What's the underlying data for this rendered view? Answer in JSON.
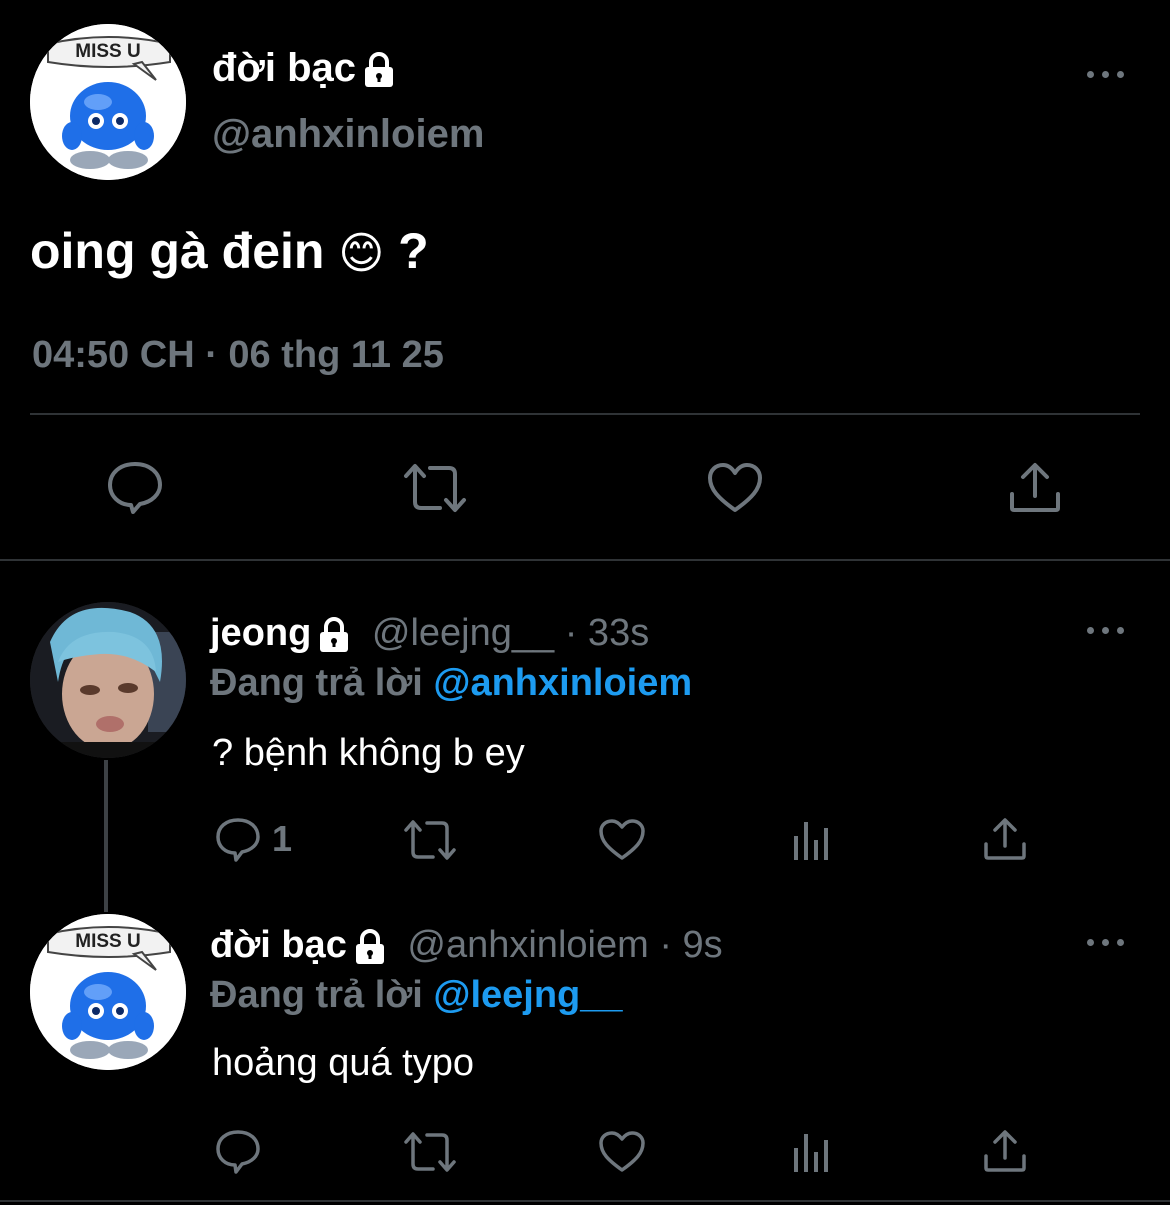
{
  "main_tweet": {
    "display_name": "đời bạc",
    "handle": "@anhxinloiem",
    "avatar_caption": "MISS U",
    "text": "oing gà đein",
    "emoji": "😊",
    "text_suffix": "?",
    "timestamp": "04:50 CH · 06 thg 11 25"
  },
  "replies": [
    {
      "display_name": "jeong",
      "handle": "@leejng__",
      "time": "· 33s",
      "replying_label": "Đang trả lời",
      "replying_to": "@anhxinloiem",
      "text": "? bệnh không b ey",
      "reply_count": "1"
    },
    {
      "display_name": "đời bạc",
      "handle": "@anhxinloiem",
      "time": "· 9s",
      "replying_label": "Đang trả lời",
      "replying_to": "@leejng__",
      "text": "hoảng quá typo",
      "avatar_caption": "MISS U",
      "reply_count": ""
    }
  ],
  "icons": {
    "reply": "reply-icon",
    "retweet": "retweet-icon",
    "like": "heart-icon",
    "share": "share-icon",
    "analytics": "analytics-icon",
    "more": "more-icon",
    "lock": "lock-icon"
  },
  "colors": {
    "background": "#000000",
    "text": "#ffffff",
    "secondary": "#6e767d",
    "link": "#1d9bf0",
    "divider": "#2f3336"
  }
}
